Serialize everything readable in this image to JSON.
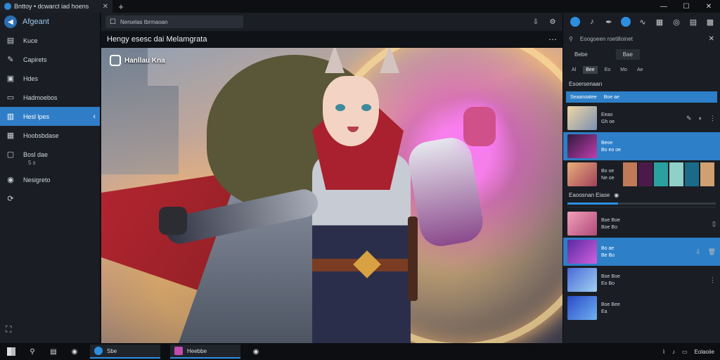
{
  "browser": {
    "tab_title": "Bnttoy • dcwarct iad hoens",
    "new_tab": "+",
    "controls": [
      "—",
      "☐",
      "✕"
    ]
  },
  "sidebar": {
    "brand": "Afgeant",
    "items": [
      {
        "label": "Kuce",
        "icon": "document-icon"
      },
      {
        "label": "Capirets",
        "icon": "brush-icon"
      },
      {
        "label": "Hdes",
        "icon": "image-icon"
      },
      {
        "label": "Hadmoebos",
        "icon": "folder-icon"
      },
      {
        "label": "Hesl lpes",
        "icon": "notes-icon",
        "active": true
      },
      {
        "label": "Hoobsbdase",
        "icon": "gallery-icon"
      },
      {
        "label": "Bosl dae",
        "icon": "frame-icon",
        "sub": "5 s"
      },
      {
        "label": "Nesigreto",
        "icon": "paint-icon"
      }
    ]
  },
  "toolbar": {
    "search_placeholder": "Nerselas tbrmaoan",
    "icons": [
      "download-icon",
      "settings-icon"
    ]
  },
  "canvas": {
    "title": "Hengy esesc dai Melamgrata",
    "watermark": "Hanllau Kna"
  },
  "right_panel": {
    "search_placeholder": "Eoogoeen roetilloinet",
    "tabs": [
      "Bebe",
      "Bae"
    ],
    "chips": [
      "Al",
      "Bee",
      "Eo",
      "Mo",
      "Ae"
    ],
    "section1": "Esoersenaan",
    "highlight_bar": [
      "Seaanoatee",
      "Boe ae"
    ],
    "items1": [
      {
        "name": "Eeao",
        "meta": "Gh oe"
      },
      {
        "name": "Beoe",
        "meta": "Bo eo oe",
        "selected": true
      },
      {
        "name": "Bo oe",
        "meta": "Ne oe"
      }
    ],
    "section2": "Eaoosnan Eiase",
    "items2": [
      {
        "name": "Boe Boe",
        "meta": "Boe Bo"
      },
      {
        "name": "Bo ae",
        "meta": "Be Bo",
        "selected": true
      },
      {
        "name": "Boe Boe",
        "meta": "Eo Bo"
      },
      {
        "name": "Boe Bee",
        "meta": "Ea"
      }
    ],
    "progress": 0.34
  },
  "taskbar": {
    "apps": [
      "Sbe",
      "Heebbe"
    ],
    "tray": "Eolaoiie"
  }
}
